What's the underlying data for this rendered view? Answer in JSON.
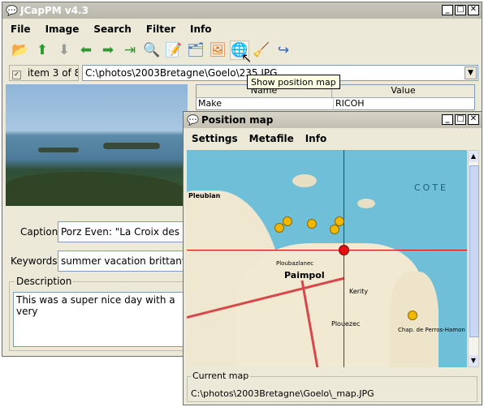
{
  "main_window": {
    "title": "JCapPM v4.3",
    "menu": [
      "File",
      "Image",
      "Search",
      "Filter",
      "Info"
    ],
    "toolbar_icons": [
      "open-folder-icon",
      "up-arrow-icon",
      "down-arrow-icon",
      "back-arrow-icon",
      "forward-arrow-icon",
      "last-arrow-icon",
      "magnifier-icon",
      "notepad-icon",
      "folder-icon",
      "image-icon",
      "globe-icon",
      "brush-icon",
      "redo-arrow-icon"
    ],
    "item_status": "item 3 of 8",
    "path": "C:\\photos\\2003Bretagne\\Goelo\\235.JPG",
    "tooltip": "Show position map",
    "exif": {
      "headers": [
        "Name",
        "Value"
      ],
      "rows": [
        [
          "Make",
          "RICOH"
        ]
      ]
    },
    "caption_label": "Caption",
    "caption_value": "Porz Even: \"La Croix des Ve",
    "keywords_label": "Keywords",
    "keywords_value": "summer vacation brittany fra",
    "description_label": "Description",
    "description_value": "This was a super nice day with a very"
  },
  "map_window": {
    "title": "Position map",
    "menu": [
      "Settings",
      "Metafile",
      "Info"
    ],
    "map_places": [
      "Pleubian",
      "Paimpol",
      "Plouezec",
      "Chap. de Perros-Hamon",
      "Kerity",
      "Ploubazlanec",
      "COTE"
    ],
    "current_map_label": "Current map",
    "current_map_path": "C:\\photos\\2003Bretagne\\Goelo\\_map.JPG"
  }
}
